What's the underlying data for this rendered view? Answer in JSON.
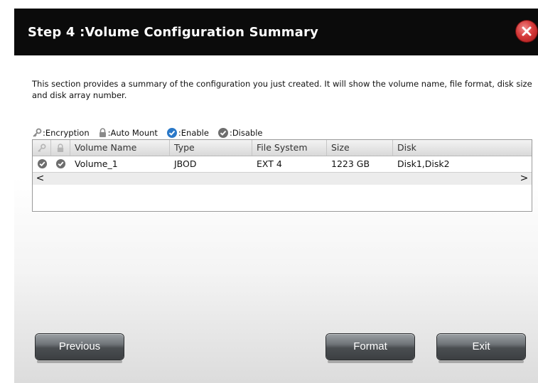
{
  "dialog": {
    "title": "Step 4 :Volume Configuration Summary",
    "description": "This section provides a summary of the configuration you just created. It will show the volume name, file format, disk size and disk array number."
  },
  "legend": {
    "encryption": ":Encryption",
    "auto_mount": ":Auto Mount",
    "enable": ":Enable",
    "disable": ":Disable"
  },
  "table": {
    "columns": [
      "",
      "",
      "Volume Name",
      "Type",
      "File System",
      "Size",
      "Disk"
    ],
    "rows": [
      {
        "encryption_icon": "disabled-check-icon",
        "auto_mount_icon": "disabled-check-icon",
        "volume_name": "Volume_1",
        "type": "JBOD",
        "file_system": "EXT 4",
        "size": "1223 GB",
        "disk": "Disk1,Disk2"
      }
    ],
    "scroll_left": "<",
    "scroll_right": ">"
  },
  "buttons": {
    "previous": "Previous",
    "format": "Format",
    "exit": "Exit"
  },
  "colors": {
    "titlebar": "#0b0b0b",
    "enable": "#2a78c8",
    "disable": "#6e6e6e",
    "close": "#d63a3a"
  }
}
